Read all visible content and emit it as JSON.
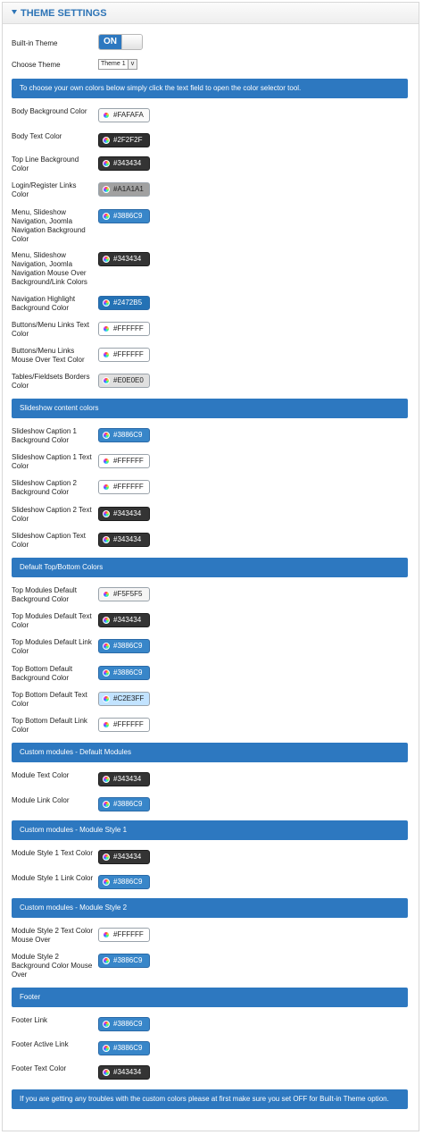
{
  "header": {
    "title": "THEME SETTINGS"
  },
  "builtin": {
    "label": "Built-in Theme",
    "toggle": "ON"
  },
  "choose": {
    "label": "Choose Theme",
    "selected": "Theme 1",
    "arrow": "v"
  },
  "intro": "To choose your own colors below simply click the text field to open the color selector tool.",
  "colors": [
    {
      "label": "Body Background Color",
      "value": "#FAFAFA",
      "bg": "#FAFAFA",
      "fg": "#222222"
    },
    {
      "label": "Body Text Color",
      "value": "#2F2F2F",
      "bg": "#2F2F2F",
      "fg": "#FFFFFF"
    },
    {
      "label": "Top Line Background Color",
      "value": "#343434",
      "bg": "#343434",
      "fg": "#FFFFFF"
    },
    {
      "label": "Login/Register Links Color",
      "value": "#A1A1A1",
      "bg": "#A1A1A1",
      "fg": "#222222"
    },
    {
      "label": "Menu, Slideshow Navigation, Joomla Navigation Background Color",
      "value": "#3886C9",
      "bg": "#3886C9",
      "fg": "#FFFFFF"
    },
    {
      "label": "Menu, Slideshow Navigation, Joomla Navigation Mouse Over Background/Link Colors",
      "value": "#343434",
      "bg": "#343434",
      "fg": "#FFFFFF"
    },
    {
      "label": "Navigation Highlight Background Color",
      "value": "#2472B5",
      "bg": "#2472B5",
      "fg": "#FFFFFF"
    },
    {
      "label": "Buttons/Menu Links Text Color",
      "value": "#FFFFFF",
      "bg": "#FFFFFF",
      "fg": "#222222"
    },
    {
      "label": "Buttons/Menu Links Mouse Over Text Color",
      "value": "#FFFFFF",
      "bg": "#FFFFFF",
      "fg": "#222222"
    },
    {
      "label": "Tables/Fieldsets Borders Color",
      "value": "#E0E0E0",
      "bg": "#E0E0E0",
      "fg": "#222222"
    }
  ],
  "slideshow": {
    "title": "Slideshow content colors",
    "items": [
      {
        "label": "Slideshow Caption 1 Background Color",
        "value": "#3886C9",
        "bg": "#3886C9",
        "fg": "#FFFFFF"
      },
      {
        "label": "Slideshow Caption 1 Text Color",
        "value": "#FFFFFF",
        "bg": "#FFFFFF",
        "fg": "#222222"
      },
      {
        "label": "Slideshow Caption 2 Background Color",
        "value": "#FFFFFF",
        "bg": "#FFFFFF",
        "fg": "#222222"
      },
      {
        "label": "Slideshow Caption 2 Text Color",
        "value": "#343434",
        "bg": "#343434",
        "fg": "#FFFFFF"
      },
      {
        "label": "Slideshow Caption Text Color",
        "value": "#343434",
        "bg": "#343434",
        "fg": "#FFFFFF"
      }
    ]
  },
  "topbottom": {
    "title": "Default Top/Bottom Colors",
    "items": [
      {
        "label": "Top Modules Default Background Color",
        "value": "#F5F5F5",
        "bg": "#F5F5F5",
        "fg": "#222222"
      },
      {
        "label": "Top Modules Default Text Color",
        "value": "#343434",
        "bg": "#343434",
        "fg": "#FFFFFF"
      },
      {
        "label": "Top Modules Default Link Color",
        "value": "#3886C9",
        "bg": "#3886C9",
        "fg": "#FFFFFF"
      },
      {
        "label": "Top Bottom Default Background Color",
        "value": "#3886C9",
        "bg": "#3886C9",
        "fg": "#FFFFFF"
      },
      {
        "label": "Top Bottom Default Text Color",
        "value": "#C2E3FF",
        "bg": "#C2E3FF",
        "fg": "#222222"
      },
      {
        "label": "Top Bottom Default Link Color",
        "value": "#FFFFFF",
        "bg": "#FFFFFF",
        "fg": "#222222"
      }
    ]
  },
  "custom_default": {
    "title": "Custom modules - Default Modules",
    "items": [
      {
        "label": "Module Text Color",
        "value": "#343434",
        "bg": "#343434",
        "fg": "#FFFFFF"
      },
      {
        "label": "Module Link Color",
        "value": "#3886C9",
        "bg": "#3886C9",
        "fg": "#FFFFFF"
      }
    ]
  },
  "custom_style1": {
    "title": "Custom modules - Module Style 1",
    "items": [
      {
        "label": "Module Style 1 Text Color",
        "value": "#343434",
        "bg": "#343434",
        "fg": "#FFFFFF"
      },
      {
        "label": "Module Style 1 Link Color",
        "value": "#3886C9",
        "bg": "#3886C9",
        "fg": "#FFFFFF"
      }
    ]
  },
  "custom_style2": {
    "title": "Custom modules - Module Style 2",
    "items": [
      {
        "label": "Module Style 2 Text Color Mouse Over",
        "value": "#FFFFFF",
        "bg": "#FFFFFF",
        "fg": "#222222"
      },
      {
        "label": "Module Style 2 Background Color Mouse Over",
        "value": "#3886C9",
        "bg": "#3886C9",
        "fg": "#FFFFFF"
      }
    ]
  },
  "footer": {
    "title": "Footer",
    "items": [
      {
        "label": "Footer Link",
        "value": "#3886C9",
        "bg": "#3886C9",
        "fg": "#FFFFFF"
      },
      {
        "label": "Footer Active Link",
        "value": "#3886C9",
        "bg": "#3886C9",
        "fg": "#FFFFFF"
      },
      {
        "label": "Footer Text Color",
        "value": "#343434",
        "bg": "#343434",
        "fg": "#FFFFFF"
      }
    ]
  },
  "note": "If you are getting any troubles with the custom colors please at first make sure you set OFF for Built-in Theme option."
}
